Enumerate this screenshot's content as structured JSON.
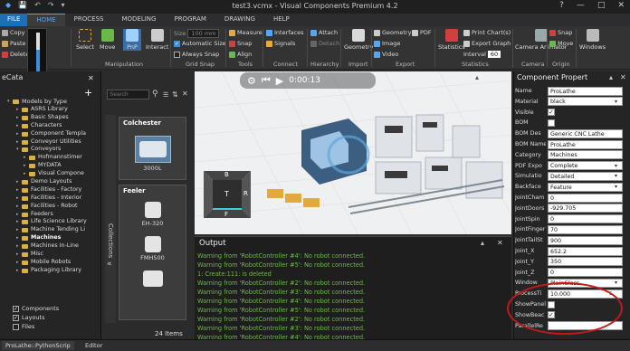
{
  "window": {
    "title": "test3.vcmx - Visual Components Premium 4.2",
    "controls": [
      "?",
      "—",
      "□",
      "✕"
    ]
  },
  "menu": {
    "items": [
      "FILE",
      "HOME",
      "PROCESS",
      "MODELING",
      "PROGRAM",
      "DRAWING",
      "HELP"
    ],
    "active": "HOME"
  },
  "ribbon": {
    "clipboard": [
      "Copy",
      "Paste",
      "Delete"
    ],
    "manipulation": {
      "label": "Manipulation",
      "buttons": [
        "Select",
        "Move",
        "PnP",
        "Interact"
      ]
    },
    "grid_snap": {
      "label": "Grid Snap",
      "size_placeholder": "Size",
      "size_value": "100 mm",
      "auto_size": "Automatic Size",
      "always_snap": "Always Snap"
    },
    "tools": {
      "label": "Tools",
      "items": [
        "Measure",
        "Snap",
        "Align"
      ]
    },
    "connect": {
      "label": "Connect",
      "items": [
        "Interfaces",
        "Signals"
      ]
    },
    "hierarchy": {
      "label": "Hierarchy",
      "items": [
        "Attach",
        "Detach"
      ]
    },
    "import": {
      "label": "Import",
      "button": "Geometry"
    },
    "export": {
      "label": "Export",
      "items": [
        "Geometry",
        "PDF",
        "Image",
        "Video"
      ]
    },
    "statistics": {
      "label": "Statistics",
      "button": "Statistics",
      "items": [
        "Print Chart(s)",
        "Export Graph"
      ],
      "interval_label": "Interval",
      "interval_value": "60"
    },
    "camera": {
      "label": "Camera",
      "button": "Camera Animator"
    },
    "origin": {
      "label": "Origin",
      "items": [
        "Snap",
        "Move"
      ]
    },
    "windows": {
      "button": "Windows"
    },
    "accent": "#3a8fd8"
  },
  "ecatalog": {
    "title": "eCata",
    "header": "Models by Type",
    "tree": [
      {
        "label": "ASRS Library",
        "level": 1
      },
      {
        "label": "Basic Shapes",
        "level": 1
      },
      {
        "label": "Characters",
        "level": 1
      },
      {
        "label": "Component Templa",
        "level": 1
      },
      {
        "label": "Conveyor Utilities",
        "level": 1
      },
      {
        "label": "Conveyors",
        "level": 1
      },
      {
        "label": "Hofmannstimer",
        "level": 2
      },
      {
        "label": "MYDATA",
        "level": 2
      },
      {
        "label": "Visual Compone",
        "level": 2
      },
      {
        "label": "Demo Layouts",
        "level": 1
      },
      {
        "label": "Facilities - Factory",
        "level": 1
      },
      {
        "label": "Facilities - Interior",
        "level": 1
      },
      {
        "label": "Facilities - Robot",
        "level": 1
      },
      {
        "label": "Feeders",
        "level": 1
      },
      {
        "label": "Life Science Library",
        "level": 1
      },
      {
        "label": "Machine Tending Li",
        "level": 1
      },
      {
        "label": "Machines",
        "level": 1
      },
      {
        "label": "Machines In-Line",
        "level": 1
      },
      {
        "label": "Misc",
        "level": 1
      },
      {
        "label": "Mobile Robots",
        "level": 1
      },
      {
        "label": "Packaging Library",
        "level": 1
      }
    ],
    "filters": [
      {
        "label": "Components",
        "checked": true
      },
      {
        "label": "Layouts",
        "checked": true
      },
      {
        "label": "Files",
        "checked": false
      }
    ]
  },
  "collection": {
    "search_placeholder": "Search",
    "tab_label": "Collections",
    "group1": {
      "title": "Colchester",
      "item": "3000L"
    },
    "group2": {
      "title": "Feeler",
      "items": [
        "EH-320",
        "FMH500",
        ""
      ]
    },
    "count": "24 Items"
  },
  "viewport": {
    "time": "0:00:13",
    "navcube": {
      "top": "B",
      "center": "T",
      "right": "R",
      "bottom": "F"
    }
  },
  "output": {
    "title": "Output",
    "lines": [
      "Warning from 'RobotController #4': No robot connected.",
      "Warning from 'RobotController #5': No robot connected.",
      "1: Create:111: is deleted",
      "Warning from 'RobotController #2': No robot connected.",
      "Warning from 'RobotController #3': No robot connected.",
      "Warning from 'RobotController #4': No robot connected.",
      "Warning from 'RobotController #5': No robot connected.",
      "Warning from 'RobotController #2': No robot connected.",
      "Warning from 'RobotController #3': No robot connected.",
      "Warning from 'RobotController #4': No robot connected."
    ]
  },
  "properties": {
    "title": "Component Propert",
    "rows": [
      {
        "label": "Name",
        "value": "ProLathe",
        "type": "text"
      },
      {
        "label": "Material",
        "value": "black",
        "type": "select"
      },
      {
        "label": "Visible",
        "value": "✓",
        "type": "check"
      },
      {
        "label": "BOM",
        "value": "",
        "type": "check"
      },
      {
        "label": "BOM Des",
        "value": "Generic CNC Lathe",
        "type": "text"
      },
      {
        "label": "BOM Name",
        "value": "ProLathe",
        "type": "text"
      },
      {
        "label": "Category",
        "value": "Machines",
        "type": "text"
      },
      {
        "label": "PDF Expo",
        "value": "Complete",
        "type": "select"
      },
      {
        "label": "Simulatio",
        "value": "Detailed",
        "type": "select"
      },
      {
        "label": "Backface",
        "value": "Feature",
        "type": "select"
      },
      {
        "label": "JointCham",
        "value": "0",
        "type": "text"
      },
      {
        "label": "JointDoors",
        "value": "-929.705",
        "type": "text"
      },
      {
        "label": "JointSpin",
        "value": "0",
        "type": "text"
      },
      {
        "label": "JointFinger",
        "value": "70",
        "type": "text"
      },
      {
        "label": "JointTailSt",
        "value": "900",
        "type": "text"
      },
      {
        "label": "Joint_X",
        "value": "652.2",
        "type": "text"
      },
      {
        "label": "Joint_Y",
        "value": "350",
        "type": "text"
      },
      {
        "label": "Joint_Z",
        "value": "0",
        "type": "text"
      },
      {
        "label": "Window",
        "value": "PlainGlass",
        "type": "select"
      },
      {
        "label": "ProcessTi",
        "value": "10.000",
        "type": "text",
        "unit": "s"
      },
      {
        "label": "ShowPanel",
        "value": "",
        "type": "check"
      },
      {
        "label": "ShowBeac",
        "value": "✓",
        "type": "check"
      },
      {
        "label": "ParallelRe",
        "value": "",
        "type": "text"
      }
    ]
  },
  "statusbar": {
    "tabs": [
      "ProLathe::PythonScrip",
      "Editor"
    ]
  }
}
